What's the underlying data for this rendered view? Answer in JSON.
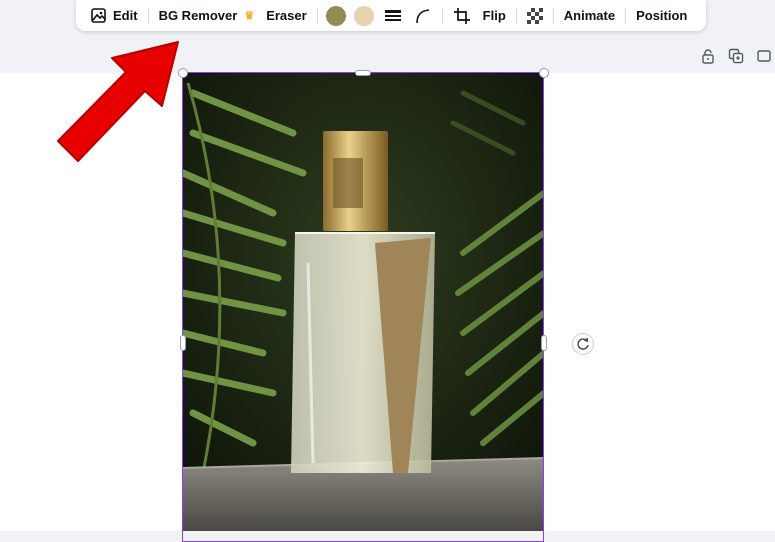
{
  "toolbar": {
    "edit_label": "Edit",
    "bg_remover_label": "BG Remover",
    "eraser_label": "Eraser",
    "flip_label": "Flip",
    "animate_label": "Animate",
    "position_label": "Position",
    "icons": [
      "edit-image-icon",
      "crown-icon",
      "border-style-icon",
      "corner-rounding-icon",
      "crop-icon",
      "transparency-icon"
    ],
    "swatches": [
      "#8d8d55",
      "#e6d3ad"
    ]
  },
  "page_actions": {
    "icons": [
      "lock-icon",
      "duplicate-icon",
      "add-page-icon"
    ]
  },
  "image": {
    "subject": "perfume-bottle-with-fern-leaves",
    "selection_color": "#8b3dff"
  },
  "annotation": {
    "arrow_color": "#e60000"
  }
}
